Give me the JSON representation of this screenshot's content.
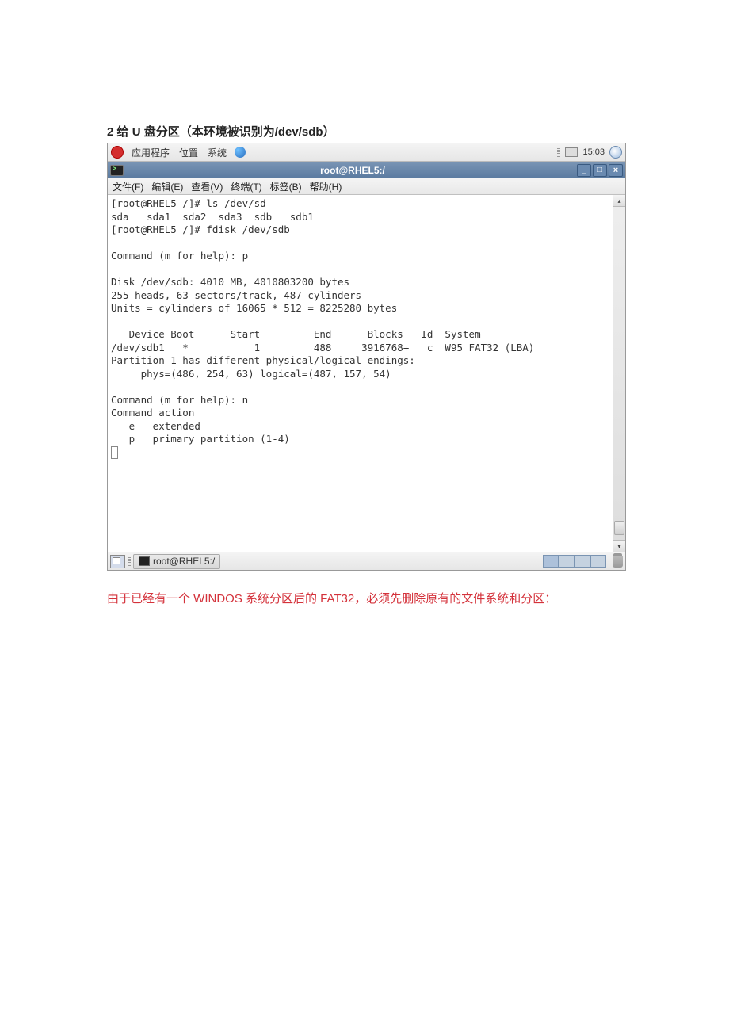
{
  "doc": {
    "heading_num": "2",
    "heading_cn_a": " 给 ",
    "heading_u": "U",
    "heading_cn_b": " 盘分区（本环境被识别为",
    "heading_dev": "/dev/sdb",
    "heading_cn_c": "）",
    "caption": "由于已经有一个 WINDOS 系统分区后的 FAT32，必须先删除原有的文件系统和分区："
  },
  "top_panel": {
    "apps": "应用程序",
    "places": "位置",
    "system": "系统",
    "clock": "15:03"
  },
  "window": {
    "title": "root@RHEL5:/"
  },
  "term_menu": {
    "file": "文件(F)",
    "edit": "编辑(E)",
    "view": "查看(V)",
    "terminal": "终端(T)",
    "tabs": "标签(B)",
    "help": "帮助(H)"
  },
  "terminal": {
    "lines": "[root@RHEL5 /]# ls /dev/sd\nsda   sda1  sda2  sda3  sdb   sdb1\n[root@RHEL5 /]# fdisk /dev/sdb\n\nCommand (m for help): p\n\nDisk /dev/sdb: 4010 MB, 4010803200 bytes\n255 heads, 63 sectors/track, 487 cylinders\nUnits = cylinders of 16065 * 512 = 8225280 bytes\n\n   Device Boot      Start         End      Blocks   Id  System\n/dev/sdb1   *           1         488     3916768+   c  W95 FAT32 (LBA)\nPartition 1 has different physical/logical endings:\n     phys=(486, 254, 63) logical=(487, 157, 54)\n\nCommand (m for help): n\nCommand action\n   e   extended\n   p   primary partition (1-4)"
  },
  "taskbar": {
    "task_title": "root@RHEL5:/"
  }
}
